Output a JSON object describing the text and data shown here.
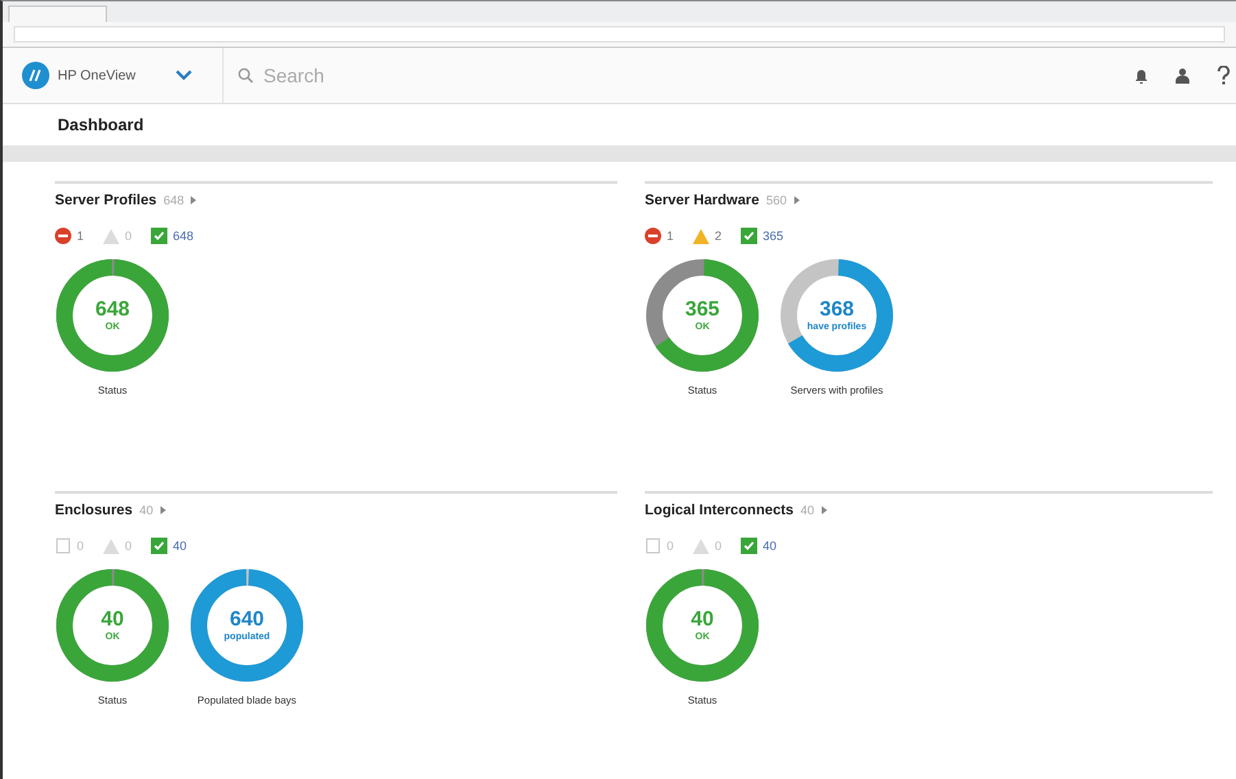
{
  "app": {
    "name": "HP OneView"
  },
  "search": {
    "placeholder": "Search"
  },
  "page_title": "Dashboard",
  "panels": [
    {
      "title": "Server Profiles",
      "count": "648",
      "status": [
        {
          "kind": "critical",
          "count": "1",
          "active": true
        },
        {
          "kind": "warning",
          "count": "0",
          "active": false
        },
        {
          "kind": "ok",
          "count": "648",
          "active": true
        }
      ],
      "donuts": [
        {
          "kind": "status",
          "level": 1,
          "value": "648",
          "label": "OK",
          "caption": "Status"
        }
      ]
    },
    {
      "title": "Server Hardware",
      "count": "560",
      "status": [
        {
          "kind": "critical",
          "count": "1",
          "active": true
        },
        {
          "kind": "warning",
          "count": "2",
          "active": true
        },
        {
          "kind": "ok",
          "count": "365",
          "active": true
        }
      ],
      "donuts": [
        {
          "kind": "status",
          "level": 0.65,
          "value": "365",
          "label": "OK",
          "caption": "Status"
        },
        {
          "kind": "usage",
          "level": 0.66,
          "value": "368",
          "label": "have profiles",
          "caption": "Servers with profiles"
        }
      ]
    },
    {
      "title": "Enclosures",
      "count": "40",
      "status": [
        {
          "kind": "critical",
          "count": "0",
          "active": false
        },
        {
          "kind": "warning",
          "count": "0",
          "active": false
        },
        {
          "kind": "ok",
          "count": "40",
          "active": true
        }
      ],
      "donuts": [
        {
          "kind": "status",
          "level": 1,
          "value": "40",
          "label": "OK",
          "caption": "Status"
        },
        {
          "kind": "usage",
          "level": 1,
          "value": "640",
          "label": "populated",
          "caption": "Populated blade bays"
        }
      ]
    },
    {
      "title": "Logical Interconnects",
      "count": "40",
      "status": [
        {
          "kind": "critical",
          "count": "0",
          "active": false
        },
        {
          "kind": "warning",
          "count": "0",
          "active": false
        },
        {
          "kind": "ok",
          "count": "40",
          "active": true
        }
      ],
      "donuts": [
        {
          "kind": "status",
          "level": 1,
          "value": "40",
          "label": "OK",
          "caption": "Status"
        }
      ]
    }
  ]
}
